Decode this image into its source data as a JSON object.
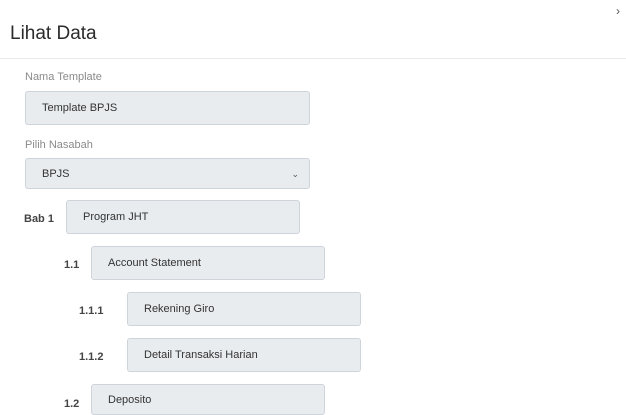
{
  "modal": {
    "title": "Lihat Data",
    "close_glyph": "›"
  },
  "form": {
    "nama_template_label": "Nama Template",
    "nama_template_value": "Template BPJS",
    "pilih_nasabah_label": "Pilih Nasabah",
    "pilih_nasabah_value": "BPJS"
  },
  "structure": [
    {
      "number": "Bab 1",
      "title": "Program JHT"
    },
    {
      "number": "1.1",
      "title": "Account Statement"
    },
    {
      "number": "1.1.1",
      "title": "Rekening Giro"
    },
    {
      "number": "1.1.2",
      "title": "Detail Transaksi Harian"
    },
    {
      "number": "1.2",
      "title": "Deposito"
    }
  ]
}
